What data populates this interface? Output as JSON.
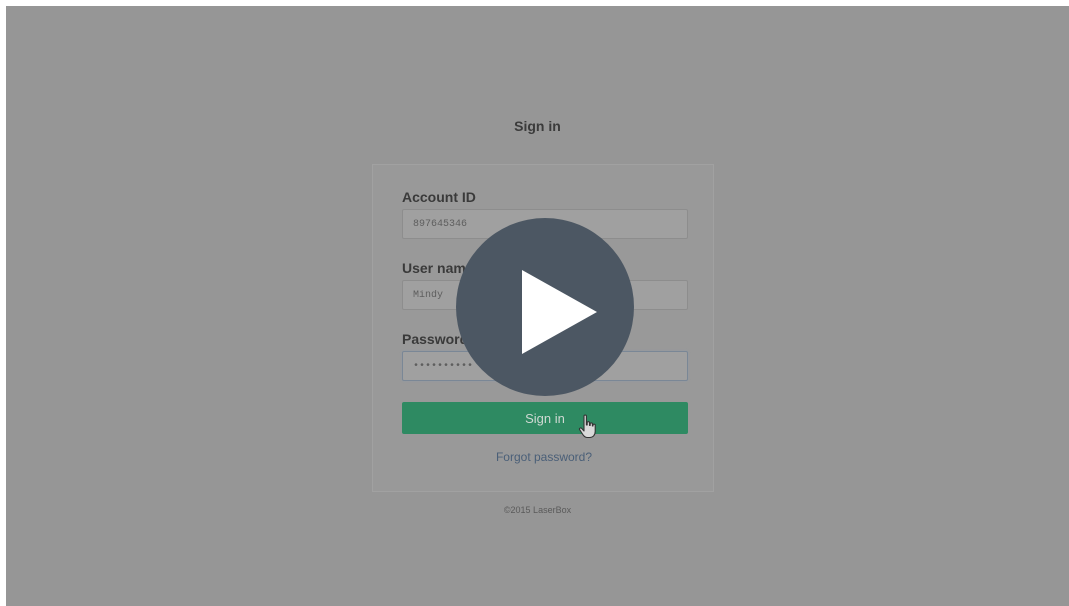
{
  "page": {
    "title": "Sign in",
    "footer": "©2015 LaserBox"
  },
  "form": {
    "account_id": {
      "label": "Account ID",
      "value": "897645346"
    },
    "username": {
      "label": "User name",
      "value": "Mindy"
    },
    "password": {
      "label": "Password",
      "value": "••••••••••"
    },
    "submit_label": "Sign in",
    "forgot_label": "Forgot password?"
  },
  "overlay": {
    "icon": "play-icon"
  },
  "colors": {
    "accent": "#2e8a62",
    "link": "#4a5f78",
    "play_button": "#4c5763"
  }
}
